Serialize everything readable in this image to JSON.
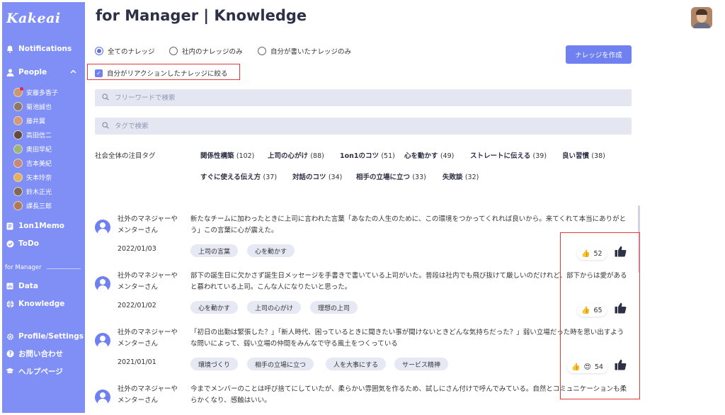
{
  "app": {
    "logo": "Kakeai",
    "page_title": "for Manager | Knowledge"
  },
  "sidebar": {
    "notifications": "Notifications",
    "people": "People",
    "people_list": [
      "安藤多香子",
      "菊池誠也",
      "藤井翼",
      "高田信二",
      "奥田早紀",
      "吉本美紀",
      "矢本玲奈",
      "鈴木正光",
      "課長三郎"
    ],
    "memo": "1on1Memo",
    "todo": "ToDo",
    "section": "for Manager",
    "data": "Data",
    "knowledge": "Knowledge",
    "profile": "Profile/Settings",
    "contact": "お問い合わせ",
    "help": "ヘルプページ"
  },
  "filters": {
    "radio_all": "全てのナレッジ",
    "radio_internal": "社内のナレッジのみ",
    "radio_mine": "自分が書いたナレッジのみ",
    "checkbox_reacted": "自分がリアクションしたナレッジに絞る",
    "create_button": "ナレッジを作成",
    "freeword_placeholder": "フリーワードで検索",
    "tag_placeholder": "タグで検索"
  },
  "hot_tags": {
    "label": "社会全体の注目タグ",
    "items": [
      {
        "name": "関係性構築",
        "count": "(102)"
      },
      {
        "name": "上司の心がけ",
        "count": "(88)"
      },
      {
        "name": "1on1のコツ",
        "count": "(51)"
      },
      {
        "name": "心を動かす",
        "count": "(49)"
      },
      {
        "name": "ストレートに伝える",
        "count": "(39)"
      },
      {
        "name": "良い習慣",
        "count": "(38)"
      },
      {
        "name": "すぐに使える伝え方",
        "count": "(37)"
      },
      {
        "name": "対話のコツ",
        "count": "(34)"
      },
      {
        "name": "相手の立場に立つ",
        "count": "(33)"
      },
      {
        "name": "失敗談",
        "count": "(32)"
      }
    ]
  },
  "knowledge": [
    {
      "author": "社外のマネジャーやメンターさん",
      "date": "2022/01/03",
      "text": "新たなチームに加わったときに上司に言われた言葉「あなたの人生のために、この環境をつかってくれれば良いから。来てくれて本当にありがとう」この言葉に心が震えた。",
      "tags": [
        "上司の言葉",
        "心を動かす"
      ],
      "reaction_count": "52"
    },
    {
      "author": "社外のマネジャーやメンターさん",
      "date": "2022/01/02",
      "text": "部下の誕生日に欠かさず誕生日メッセージを手書きで書いている上司がいた。普段は社内でも飛び抜けて厳しいのだけれど、部下からは愛があると慕われている上司。こんな人になりたいと思った。",
      "tags": [
        "心を動かす",
        "上司の心がけ",
        "理想の上司"
      ],
      "reaction_count": "65"
    },
    {
      "author": "社外のマネジャーやメンターさん",
      "date": "2021/01/01",
      "text": "「初日の出勤は緊張した？」「新人時代、困っているときに聞きたい事が聞けないときどんな気持ちだった？」弱い立場だった時を思い出すような問いによって、弱い立場の仲間をみんなで守る風土をつくっている",
      "tags": [
        "環境づくり",
        "相手の立場に立つ",
        "人を大事にする",
        "サービス精神"
      ],
      "reaction_count": "54"
    },
    {
      "author": "社外のマネジャーやメンターさん",
      "text": "今までメンバーのことは呼び捨てにしていたが、柔らかい雰囲気を作るため、試しにさん付けで呼んでみている。自然とコミュニケーションも柔らかくなり、感触はいい。"
    }
  ],
  "colors": {
    "sidebar": "#7f8ff5",
    "accent": "#6f80f0",
    "highlight": "#e23a3a"
  }
}
